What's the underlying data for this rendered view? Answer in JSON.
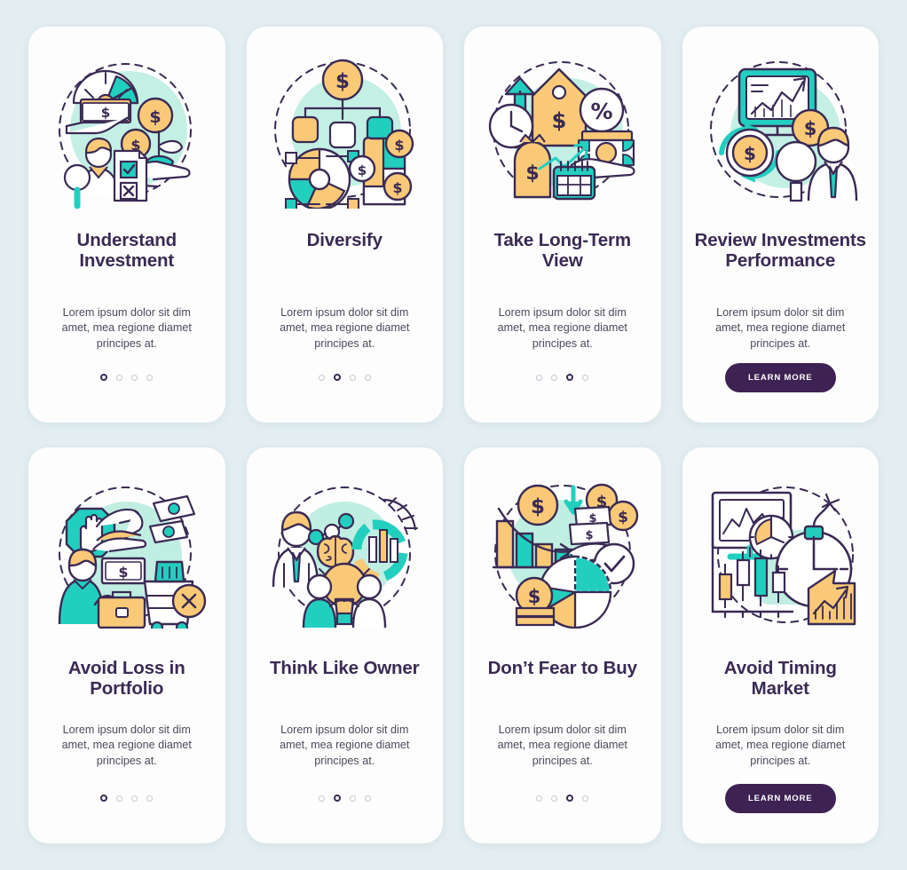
{
  "palette": {
    "background": "#e2eef1",
    "card": "#fdfdfd",
    "outline": "#3a2a54",
    "title": "#3a2a54",
    "body_text": "#4a4a5a",
    "teal": "#22cfbf",
    "mint": "#b9ecdf",
    "yellow": "#f9c978",
    "button": "#3d2253",
    "dot_inactive": "#c9c6d2",
    "dot_active": "#3a2a54"
  },
  "common": {
    "body_text": "Lorem ipsum dolor sit dim amet, mea regione diamet principes at.",
    "cta_label": "LEARN MORE",
    "dots_total": 4
  },
  "screens": [
    {
      "id": "understand-investment",
      "title": "Understand Investment",
      "body": "Lorem ipsum dolor sit dim amet, mea regione diamet principes at.",
      "footer_type": "dots",
      "active_dot": 1,
      "illustration": "understand-investment-illustration"
    },
    {
      "id": "diversify",
      "title": "Diversify",
      "body": "Lorem ipsum dolor sit dim amet, mea regione diamet principes at.",
      "footer_type": "dots",
      "active_dot": 2,
      "illustration": "diversify-illustration"
    },
    {
      "id": "take-long-term-view",
      "title": "Take Long-Term View",
      "body": "Lorem ipsum dolor sit dim amet, mea regione diamet principes at.",
      "footer_type": "dots",
      "active_dot": 3,
      "illustration": "long-term-view-illustration"
    },
    {
      "id": "review-investments-performance",
      "title": "Review Investments Performance",
      "body": "Lorem ipsum dolor sit dim amet, mea regione diamet principes at.",
      "footer_type": "button",
      "cta_label": "LEARN MORE",
      "illustration": "review-performance-illustration"
    },
    {
      "id": "avoid-loss-in-portfolio",
      "title": "Avoid Loss in Portfolio",
      "body": "Lorem ipsum dolor sit dim amet, mea regione diamet principes at.",
      "footer_type": "dots",
      "active_dot": 1,
      "illustration": "avoid-loss-illustration"
    },
    {
      "id": "think-like-owner",
      "title": "Think Like Owner",
      "body": "Lorem ipsum dolor sit dim amet, mea regione diamet principes at.",
      "footer_type": "dots",
      "active_dot": 2,
      "illustration": "think-like-owner-illustration"
    },
    {
      "id": "dont-fear-to-buy",
      "title": "Don’t Fear to Buy",
      "body": "Lorem ipsum dolor sit dim amet, mea regione diamet principes at.",
      "footer_type": "dots",
      "active_dot": 3,
      "illustration": "dont-fear-to-buy-illustration"
    },
    {
      "id": "avoid-timing-market",
      "title": "Avoid Timing Market",
      "body": "Lorem ipsum dolor sit dim amet, mea regione diamet principes at.",
      "footer_type": "button",
      "cta_label": "LEARN MORE",
      "illustration": "avoid-timing-market-illustration"
    }
  ]
}
